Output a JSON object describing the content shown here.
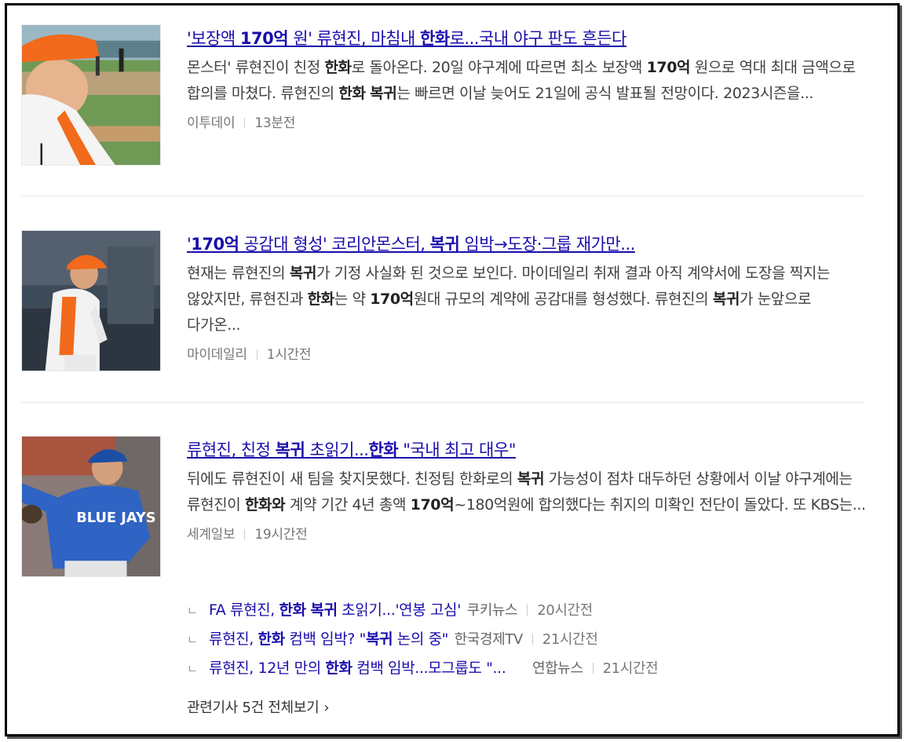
{
  "articles": [
    {
      "title_parts": [
        {
          "t": "'보장액 ",
          "b": false
        },
        {
          "t": "170억",
          "b": true
        },
        {
          "t": " 원' 류현진, 마침내 ",
          "b": false
        },
        {
          "t": "한화",
          "b": true
        },
        {
          "t": "로...국내 야구 판도 흔든다",
          "b": false
        }
      ],
      "desc_parts": [
        {
          "t": "몬스터' 류현진이 친정 ",
          "b": false
        },
        {
          "t": "한화",
          "b": true
        },
        {
          "t": "로 돌아온다. 20일 야구계에 따르면 최소 보장액 ",
          "b": false
        },
        {
          "t": "170억",
          "b": true
        },
        {
          "t": " 원으로 역대 최대 금액으로 합의를 마쳤다. 류현진의 ",
          "b": false
        },
        {
          "t": "한화",
          "b": true
        },
        {
          "t": " ",
          "b": false
        },
        {
          "t": "복귀",
          "b": true
        },
        {
          "t": "는 빠르면 이날 늦어도 21일에 공식 발표될 전망이다. 2023시즌을...",
          "b": false
        }
      ],
      "source": "이투데이",
      "time": "13분전"
    },
    {
      "title_parts": [
        {
          "t": "'",
          "b": false
        },
        {
          "t": "170억",
          "b": true
        },
        {
          "t": " 공감대 형성' 코리안몬스터, ",
          "b": false
        },
        {
          "t": "복귀",
          "b": true
        },
        {
          "t": " 임박→도장·그룹 재가만...",
          "b": false
        }
      ],
      "desc_parts": [
        {
          "t": "현재는 류현진의 ",
          "b": false
        },
        {
          "t": "복귀",
          "b": true
        },
        {
          "t": "가 기정 사실화 된 것으로 보인다. 마이데일리 취재 결과 아직 계약서에 도장을 찍지는 않았지만, 류현진과 ",
          "b": false
        },
        {
          "t": "한화",
          "b": true
        },
        {
          "t": "는 약 ",
          "b": false
        },
        {
          "t": "170억",
          "b": true
        },
        {
          "t": "원대 규모의 계약에 공감대를 형성했다. 류현진의 ",
          "b": false
        },
        {
          "t": "복귀",
          "b": true
        },
        {
          "t": "가 눈앞으로 다가온...",
          "b": false
        }
      ],
      "source": "마이데일리",
      "time": "1시간전"
    },
    {
      "title_parts": [
        {
          "t": "류현진, 친정 ",
          "b": false
        },
        {
          "t": "복귀",
          "b": true
        },
        {
          "t": " 초읽기...",
          "b": false
        },
        {
          "t": "한화",
          "b": true
        },
        {
          "t": " \"국내 최고 대우\"",
          "b": false
        }
      ],
      "desc_parts": [
        {
          "t": "뒤에도 류현진이 새 팀을 찾지못했다. 친정팀 한화로의 ",
          "b": false
        },
        {
          "t": "복귀",
          "b": true
        },
        {
          "t": " 가능성이 점차 대두하던 상황에서 이날 야구계에는 류현진이 ",
          "b": false
        },
        {
          "t": "한화와",
          "b": true
        },
        {
          "t": " 계약 기간 4년 총액 ",
          "b": false
        },
        {
          "t": "170억",
          "b": true
        },
        {
          "t": "~180억원에 합의했다는 취지의 미확인 전단이 돌았다. 또 KBS는...",
          "b": false
        }
      ],
      "source": "세계일보",
      "time": "19시간전"
    }
  ],
  "related": [
    {
      "mark": "ㄴ",
      "parts": [
        {
          "t": "FA 류현진, ",
          "b": false
        },
        {
          "t": "한화",
          "b": true
        },
        {
          "t": " ",
          "b": false
        },
        {
          "t": "복귀",
          "b": true
        },
        {
          "t": " 초읽기...'연봉 고심'",
          "b": false
        }
      ],
      "source": "쿠키뉴스",
      "time": "20시간전"
    },
    {
      "mark": "ㄴ",
      "parts": [
        {
          "t": "류현진, ",
          "b": false
        },
        {
          "t": "한화",
          "b": true
        },
        {
          "t": " 컴백 임박? \"",
          "b": false
        },
        {
          "t": "복귀",
          "b": true
        },
        {
          "t": " 논의 중\"",
          "b": false
        }
      ],
      "source": "한국경제TV",
      "time": "21시간전"
    },
    {
      "mark": "ㄴ",
      "parts": [
        {
          "t": "류현진, 12년 만의 ",
          "b": false
        },
        {
          "t": "한화",
          "b": true
        },
        {
          "t": " 컴백 임박...모그룹도 \"...",
          "b": false
        }
      ],
      "source": "연합뉴스",
      "time": "21시간전"
    }
  ],
  "more": {
    "label": "관련기사 5건 전체보기",
    "chevron": "›"
  },
  "colors": {
    "link": "#1a0dab",
    "text": "#404040",
    "meta": "#777777"
  }
}
